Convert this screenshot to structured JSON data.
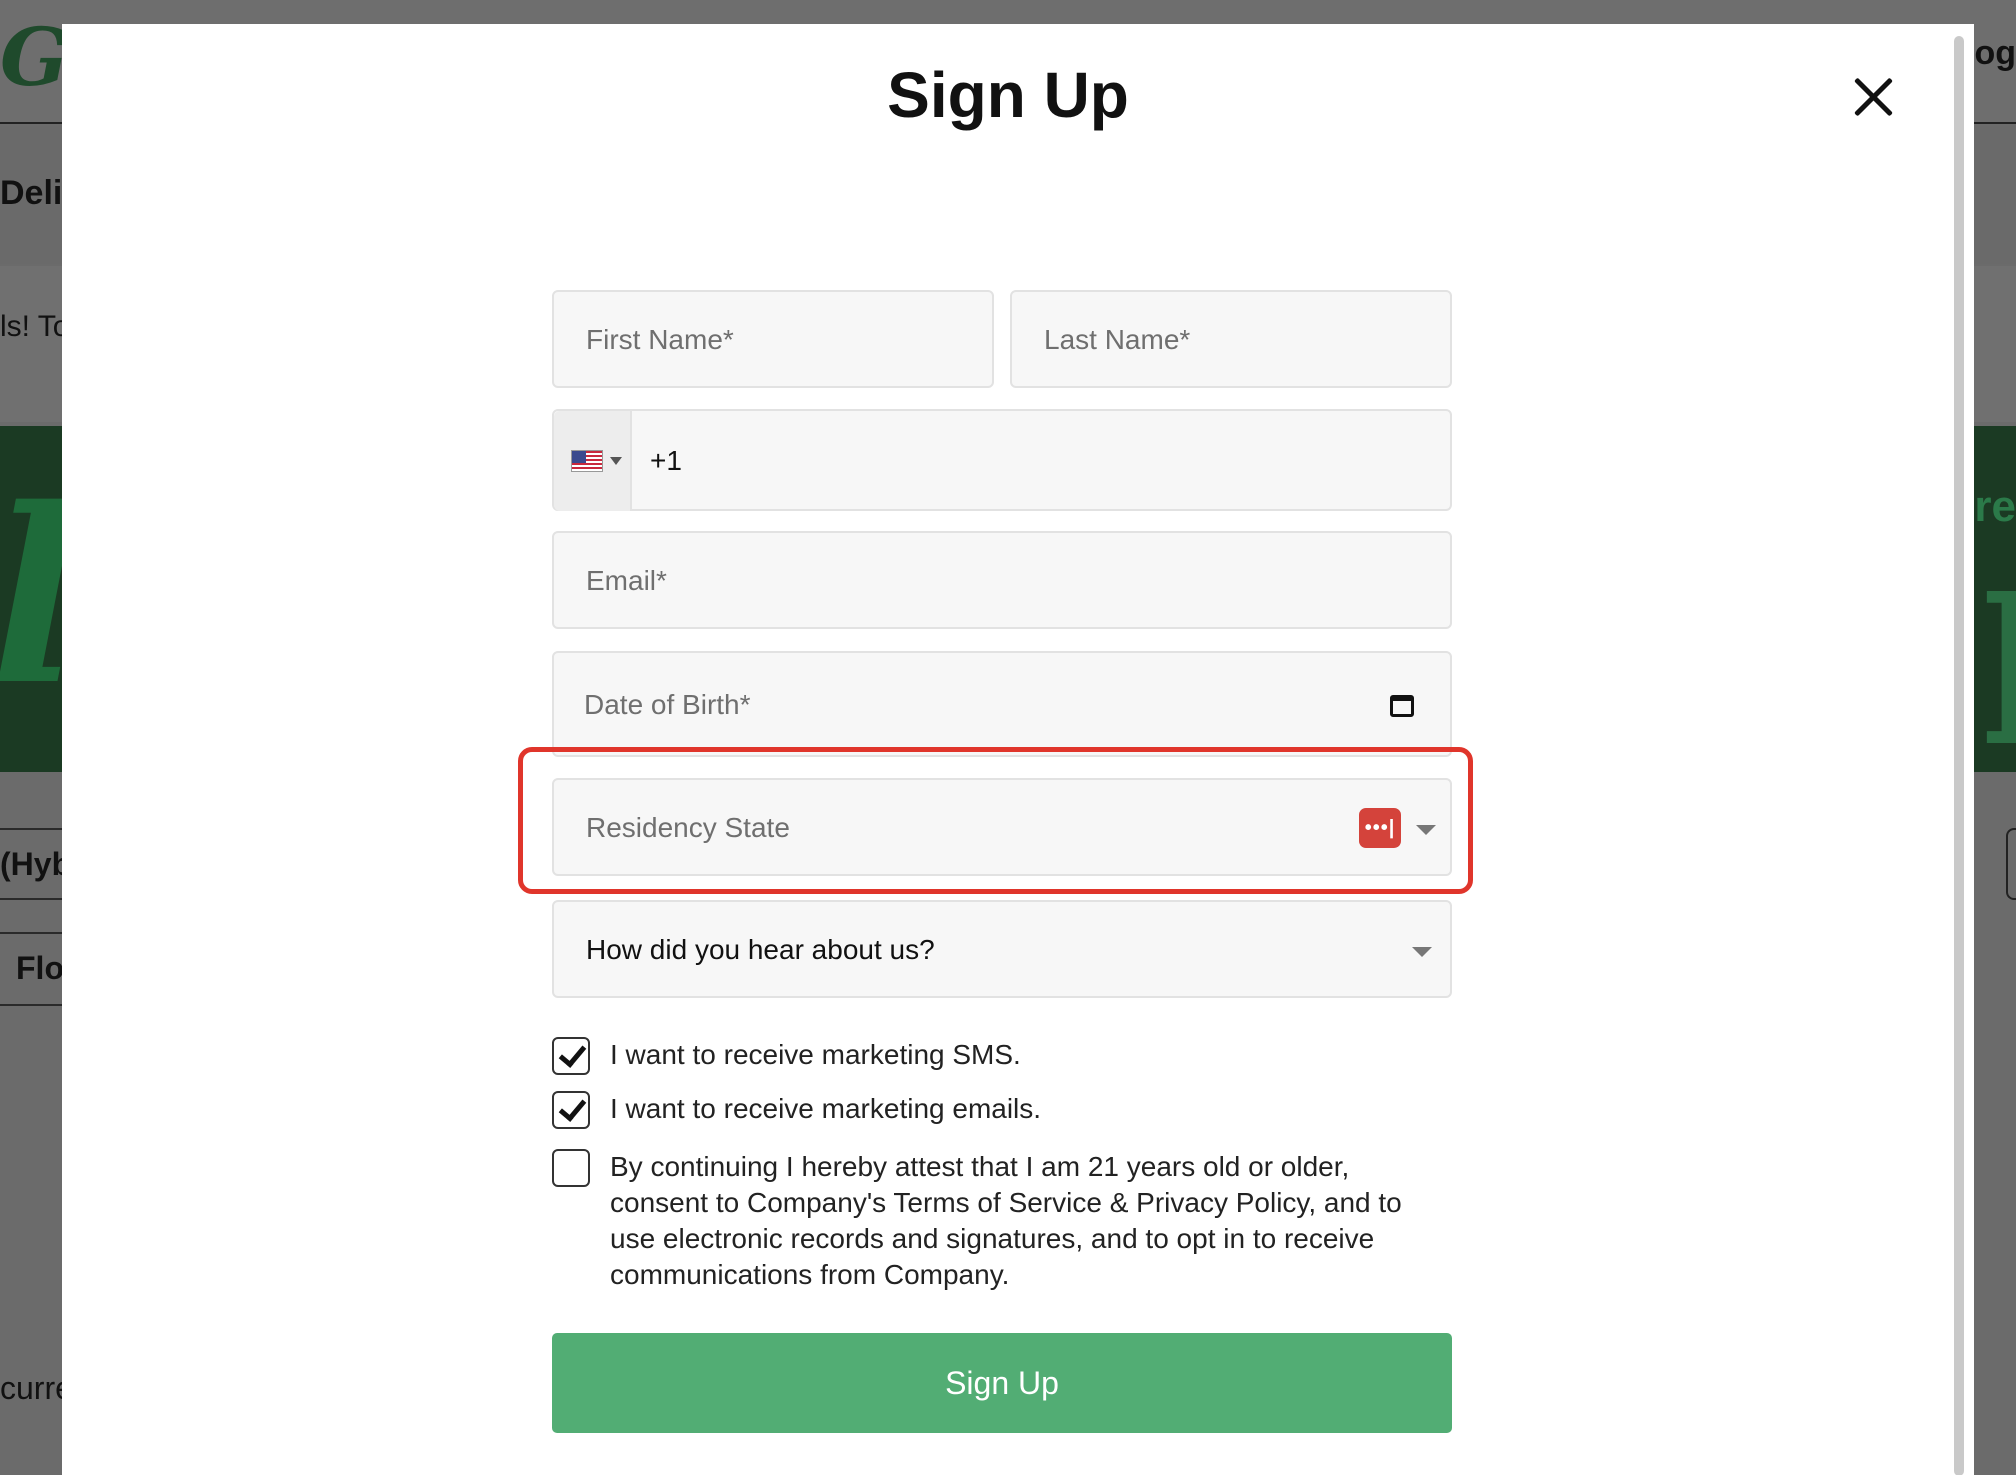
{
  "background": {
    "logo_fragment": "Gr",
    "login_fragment": "Log",
    "nav_fragment": "Deli",
    "promo_fragment": "ls! To",
    "banner_left_fragment": "le",
    "banner_right_fragment": "Pre",
    "banner_right_big_fragment": "ol",
    "row1_fragment": "(Hyb",
    "row2_fragment": "Flo",
    "footer_fragment": "curre"
  },
  "modal": {
    "title": "Sign Up",
    "first_name_placeholder": "First Name*",
    "last_name_placeholder": "Last Name*",
    "phone_country_code": "+1",
    "phone_country_flag": "us-flag-icon",
    "email_placeholder": "Email*",
    "dob_placeholder": "Date of Birth*",
    "residency_placeholder": "Residency State",
    "password_manager_icon": "•••|",
    "hear_about_value": "How did you hear about us?",
    "checkboxes": [
      {
        "label": "I want to receive marketing SMS.",
        "checked": true
      },
      {
        "label": "I want to receive marketing emails.",
        "checked": true
      },
      {
        "label": "By continuing I hereby attest that I am 21 years old or older, consent to Company's Terms of Service & Privacy Policy, and to use electronic records and signatures, and to opt in to receive communications from Company.",
        "checked": false
      }
    ],
    "submit_label": "Sign Up"
  },
  "colors": {
    "accent": "#52ad74",
    "highlight": "#e0352b",
    "password_icon": "#d4433b"
  }
}
